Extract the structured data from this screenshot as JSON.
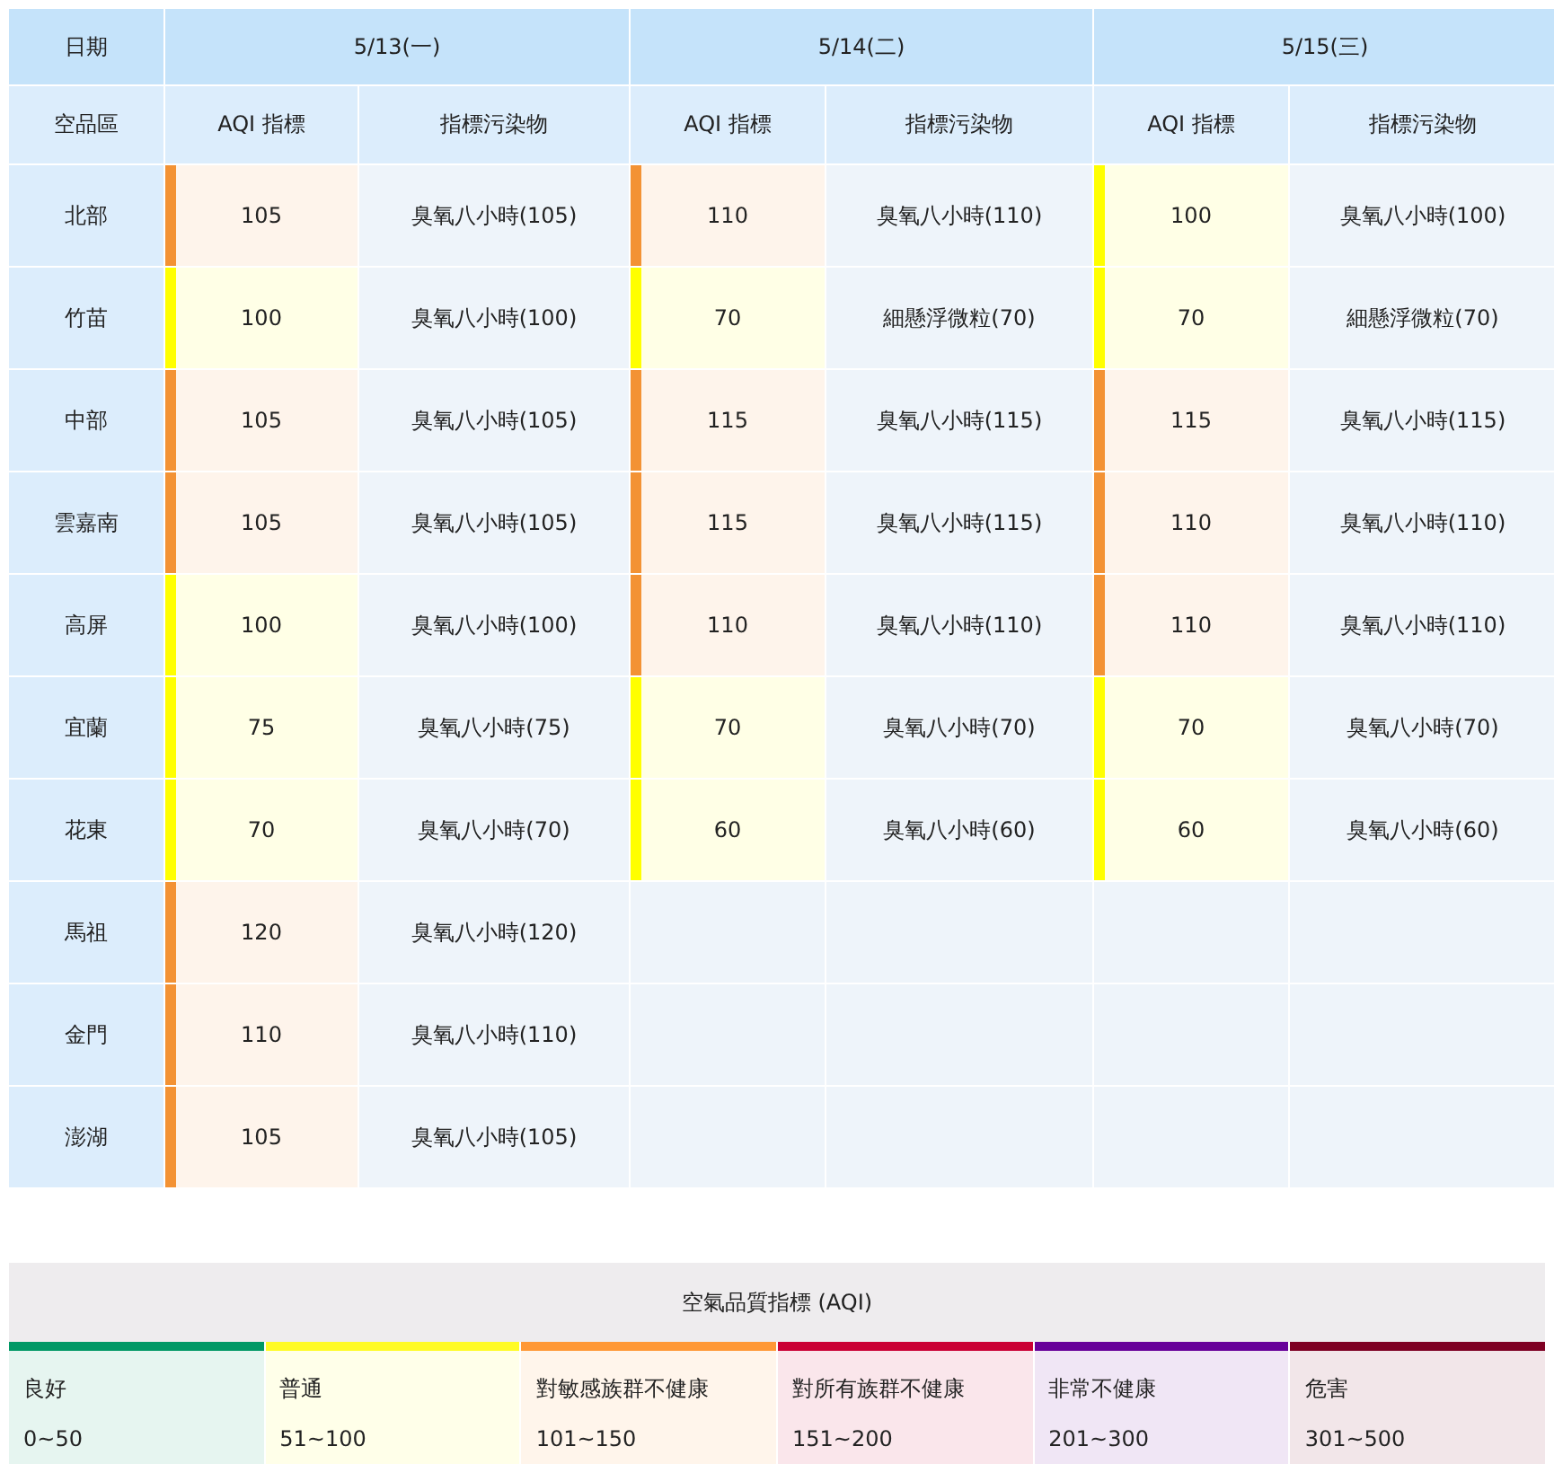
{
  "table": {
    "corner": "日期",
    "area_header": "空品區",
    "days": [
      {
        "date": "5/13(一)",
        "aqi_header": "AQI 指標",
        "pollutant_header": "指標污染物"
      },
      {
        "date": "5/14(二)",
        "aqi_header": "AQI 指標",
        "pollutant_header": "指標污染物"
      },
      {
        "date": "5/15(三)",
        "aqi_header": "AQI 指標",
        "pollutant_header": "指標污染物"
      }
    ],
    "rows": [
      {
        "area": "北部",
        "days": [
          {
            "aqi": "105",
            "pollutant": "臭氧八小時(105)",
            "color": "#f39234"
          },
          {
            "aqi": "110",
            "pollutant": "臭氧八小時(110)",
            "color": "#f39234"
          },
          {
            "aqi": "100",
            "pollutant": "臭氧八小時(100)",
            "color": "#ffff00"
          }
        ]
      },
      {
        "area": "竹苗",
        "days": [
          {
            "aqi": "100",
            "pollutant": "臭氧八小時(100)",
            "color": "#ffff00"
          },
          {
            "aqi": "70",
            "pollutant": "細懸浮微粒(70)",
            "color": "#ffff00"
          },
          {
            "aqi": "70",
            "pollutant": "細懸浮微粒(70)",
            "color": "#ffff00"
          }
        ]
      },
      {
        "area": "中部",
        "days": [
          {
            "aqi": "105",
            "pollutant": "臭氧八小時(105)",
            "color": "#f39234"
          },
          {
            "aqi": "115",
            "pollutant": "臭氧八小時(115)",
            "color": "#f39234"
          },
          {
            "aqi": "115",
            "pollutant": "臭氧八小時(115)",
            "color": "#f39234"
          }
        ]
      },
      {
        "area": "雲嘉南",
        "days": [
          {
            "aqi": "105",
            "pollutant": "臭氧八小時(105)",
            "color": "#f39234"
          },
          {
            "aqi": "115",
            "pollutant": "臭氧八小時(115)",
            "color": "#f39234"
          },
          {
            "aqi": "110",
            "pollutant": "臭氧八小時(110)",
            "color": "#f39234"
          }
        ]
      },
      {
        "area": "高屏",
        "days": [
          {
            "aqi": "100",
            "pollutant": "臭氧八小時(100)",
            "color": "#ffff00"
          },
          {
            "aqi": "110",
            "pollutant": "臭氧八小時(110)",
            "color": "#f39234"
          },
          {
            "aqi": "110",
            "pollutant": "臭氧八小時(110)",
            "color": "#f39234"
          }
        ]
      },
      {
        "area": "宜蘭",
        "days": [
          {
            "aqi": "75",
            "pollutant": "臭氧八小時(75)",
            "color": "#ffff00"
          },
          {
            "aqi": "70",
            "pollutant": "臭氧八小時(70)",
            "color": "#ffff00"
          },
          {
            "aqi": "70",
            "pollutant": "臭氧八小時(70)",
            "color": "#ffff00"
          }
        ]
      },
      {
        "area": "花東",
        "days": [
          {
            "aqi": "70",
            "pollutant": "臭氧八小時(70)",
            "color": "#ffff00"
          },
          {
            "aqi": "60",
            "pollutant": "臭氧八小時(60)",
            "color": "#ffff00"
          },
          {
            "aqi": "60",
            "pollutant": "臭氧八小時(60)",
            "color": "#ffff00"
          }
        ]
      },
      {
        "area": "馬祖",
        "days": [
          {
            "aqi": "120",
            "pollutant": "臭氧八小時(120)",
            "color": "#f39234"
          }
        ]
      },
      {
        "area": "金門",
        "days": [
          {
            "aqi": "110",
            "pollutant": "臭氧八小時(110)",
            "color": "#f39234"
          }
        ]
      },
      {
        "area": "澎湖",
        "days": [
          {
            "aqi": "105",
            "pollutant": "臭氧八小時(105)",
            "color": "#f39234"
          }
        ]
      }
    ]
  },
  "legend": {
    "title": "空氣品質指標 (AQI)",
    "levels": [
      {
        "name": "良好",
        "range": "0~50",
        "color": "#009865"
      },
      {
        "name": "普通",
        "range": "51~100",
        "color": "#fffb26"
      },
      {
        "name": "對敏感族群不健康",
        "range": "101~150",
        "color": "#ff9835"
      },
      {
        "name": "對所有族群不健康",
        "range": "151~200",
        "color": "#ca0034"
      },
      {
        "name": "非常不健康",
        "range": "201~300",
        "color": "#670099"
      },
      {
        "name": "危害",
        "range": "301~500",
        "color": "#7e0023"
      }
    ]
  }
}
